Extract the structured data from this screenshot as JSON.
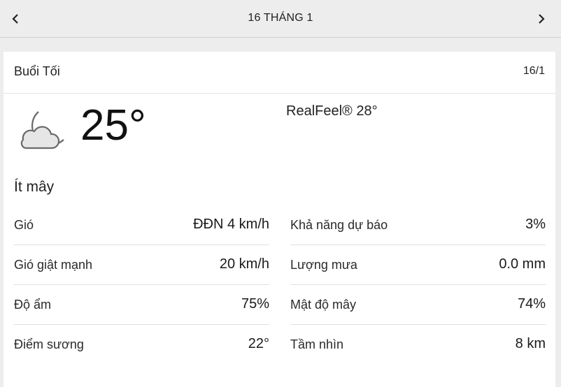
{
  "header": {
    "title": "16 THÁNG 1",
    "prev_icon": "chevron-left-icon",
    "next_icon": "chevron-right-icon"
  },
  "card": {
    "period": "Buổi Tối",
    "date": "16/1",
    "icon": "partly-cloudy-night-icon",
    "temperature": "25°",
    "realfeel": "RealFeel® 28°",
    "phrase": "Ít mây"
  },
  "details_left": [
    {
      "label": "Gió",
      "value": "ĐĐN 4 km/h"
    },
    {
      "label": "Gió giật mạnh",
      "value": "20 km/h"
    },
    {
      "label": "Độ ẩm",
      "value": "75%"
    },
    {
      "label": "Điểm sương",
      "value": "22°"
    }
  ],
  "details_right": [
    {
      "label": "Khả năng dự báo",
      "value": "3%"
    },
    {
      "label": "Lượng mưa",
      "value": "0.0 mm"
    },
    {
      "label": "Mật độ mây",
      "value": "74%"
    },
    {
      "label": "Tầm nhìn",
      "value": "8 km"
    }
  ]
}
